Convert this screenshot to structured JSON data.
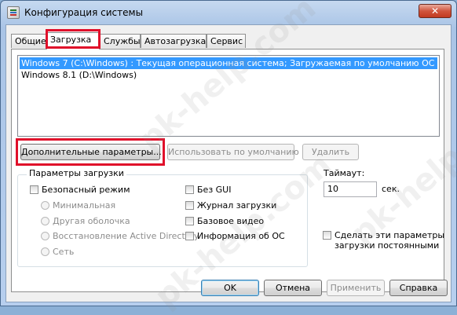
{
  "window": {
    "title": "Конфигурация системы",
    "close_label": "✕"
  },
  "tabs": [
    {
      "label": "Общие"
    },
    {
      "label": "Загрузка",
      "active": true
    },
    {
      "label": "Службы"
    },
    {
      "label": "Автозагрузка"
    },
    {
      "label": "Сервис"
    }
  ],
  "os_list": [
    {
      "label": "Windows 7 (C:\\Windows) : Текущая операционная система; Загружаемая по умолчанию ОС",
      "selected": true
    },
    {
      "label": "Windows 8.1 (D:\\Windows)",
      "selected": false
    }
  ],
  "buttons": {
    "advanced": "Дополнительные параметры...",
    "set_default": "Использовать по умолчанию",
    "delete": "Удалить",
    "ok": "OK",
    "cancel": "Отмена",
    "apply": "Применить",
    "help": "Справка"
  },
  "boot_options": {
    "title": "Параметры загрузки",
    "safe_boot": "Безопасный режим",
    "radios": [
      "Минимальная",
      "Другая оболочка",
      "Восстановление Active Directory",
      "Сеть"
    ],
    "no_gui": "Без GUI",
    "boot_log": "Журнал загрузки",
    "base_video": "Базовое видео",
    "os_info": "Информация  об ОС"
  },
  "timeout": {
    "label": "Таймаут:",
    "value": "10",
    "unit": "сек."
  },
  "permanent": {
    "line1": "Сделать эти параметры",
    "line2": "загрузки постоянными"
  },
  "watermark": "pk-help.com",
  "colors": {
    "highlight": "#3399ff",
    "annotation": "#e0102a"
  }
}
